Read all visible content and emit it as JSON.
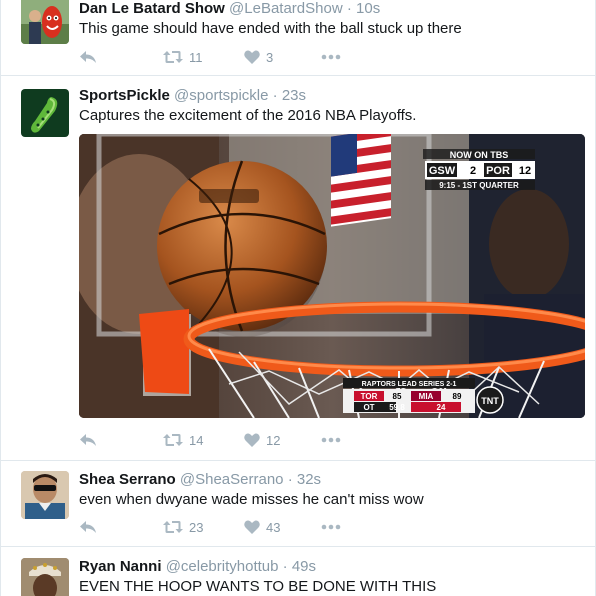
{
  "colors": {
    "text": "#14171a",
    "muted": "#8899a6",
    "icon": "#aab8c2",
    "divider": "#e1e8ed"
  },
  "tweets": [
    {
      "name": "Dan Le Batard Show",
      "handle": "@LeBatardShow",
      "sep": "·",
      "time": "10s",
      "text": "This game should have ended with the ball stuck up there",
      "retweets": "11",
      "likes": "3"
    },
    {
      "name": "SportsPickle",
      "handle": "@sportspickle",
      "sep": "·",
      "time": "23s",
      "text": "Captures the excitement of the 2016 NBA Playoffs.",
      "retweets": "14",
      "likes": "12",
      "media": {
        "tbs_header": "NOW ON TBS",
        "tbs_team1": "GSW",
        "tbs_score1": "2",
        "tbs_team2": "POR",
        "tbs_score2": "12",
        "tbs_status": "9:15 - 1ST QUARTER",
        "tnt_header": "RAPTORS LEAD SERIES 2-1",
        "tnt_team1": "TOR",
        "tnt_score1": "85",
        "tnt_team2": "MIA",
        "tnt_score2": "89",
        "tnt_period": "OT",
        "tnt_clock": "59.8",
        "tnt_shot": "24",
        "tnt_logo": "TNT"
      }
    },
    {
      "name": "Shea Serrano",
      "handle": "@SheaSerrano",
      "sep": "·",
      "time": "32s",
      "text": "even when dwyane wade misses he can't miss wow",
      "retweets": "23",
      "likes": "43"
    },
    {
      "name": "Ryan Nanni",
      "handle": "@celebrityhottub",
      "sep": "·",
      "time": "49s",
      "text": "EVEN THE HOOP WANTS TO BE DONE WITH THIS"
    }
  ]
}
